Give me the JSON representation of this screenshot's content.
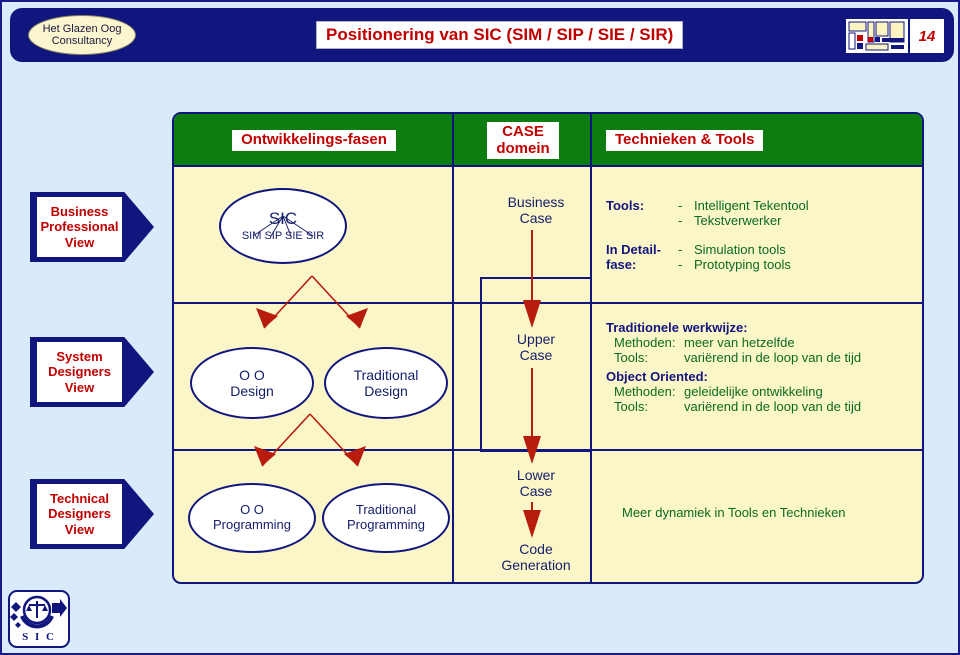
{
  "header": {
    "brand_line1": "Het Glazen Oog",
    "brand_line2": "Consultancy",
    "title": "Positionering van SIC (SIM / SIP / SIE / SIR)",
    "page_number": "14",
    "bar_color": "#11157e",
    "title_color": "#c00000"
  },
  "columns": [
    {
      "label": "Ontwikkelings-fasen"
    },
    {
      "label_line1": "CASE",
      "label_line2": "domein"
    },
    {
      "label": "Technieken & Tools"
    }
  ],
  "column_header_bg": "#0d7d12",
  "rows": [
    {
      "view_line1": "Business",
      "view_line2": "Professional",
      "view_line3": "View"
    },
    {
      "view_line1": "System",
      "view_line2": "Designers",
      "view_line3": "View"
    },
    {
      "view_line1": "Technical",
      "view_line2": "Designers",
      "view_line3": "View"
    }
  ],
  "phases": {
    "sic": {
      "title": "SIC",
      "sub": "SIM SIP SIE SIR"
    },
    "oo_design": {
      "line1": "O O",
      "line2": "Design"
    },
    "traditional_design": {
      "line1": "Traditional",
      "line2": "Design"
    },
    "oo_programming": {
      "line1": "O O",
      "line2": "Programming"
    },
    "traditional_programming": {
      "line1": "Traditional",
      "line2": "Programming"
    }
  },
  "case_domain": {
    "business_case": {
      "line1": "Business",
      "line2": "Case"
    },
    "upper_case": {
      "line1": "Upper",
      "line2": "Case"
    },
    "lower_case": {
      "line1": "Lower",
      "line2": "Case"
    },
    "code_generation": {
      "line1": "Code",
      "line2": "Generation"
    }
  },
  "tools_block": {
    "tools_label": "Tools:",
    "detail_label_line1": "In Detail-",
    "detail_label_line2": "fase:",
    "dash": "-",
    "tools_items": [
      "Intelligent Tekentool",
      "Tekstverwerker"
    ],
    "detail_items": [
      "Simulation tools",
      "Prototyping tools"
    ]
  },
  "approach_block": {
    "traditional_heading": "Traditionele werkwijze:",
    "traditional_rows": [
      {
        "label": "Methoden:",
        "value": "meer van hetzelfde"
      },
      {
        "label": "Tools:",
        "value": "variërend in de loop van de tijd"
      }
    ],
    "oo_heading": "Object Oriented:",
    "oo_rows": [
      {
        "label": "Methoden:",
        "value": "geleidelijke ontwikkeling"
      },
      {
        "label": "Tools:",
        "value": "variërend in de loop van de tijd"
      }
    ]
  },
  "dynamics_note": "Meer dynamiek in Tools en Technieken",
  "footer": {
    "logo_text": "S I C"
  },
  "colors": {
    "slide_bg": "#d9ebfa",
    "cell_bg": "#fbf6c8",
    "navy": "#11157e",
    "green_text": "#0a6b1e",
    "red_arrow": "#b71c0c"
  }
}
